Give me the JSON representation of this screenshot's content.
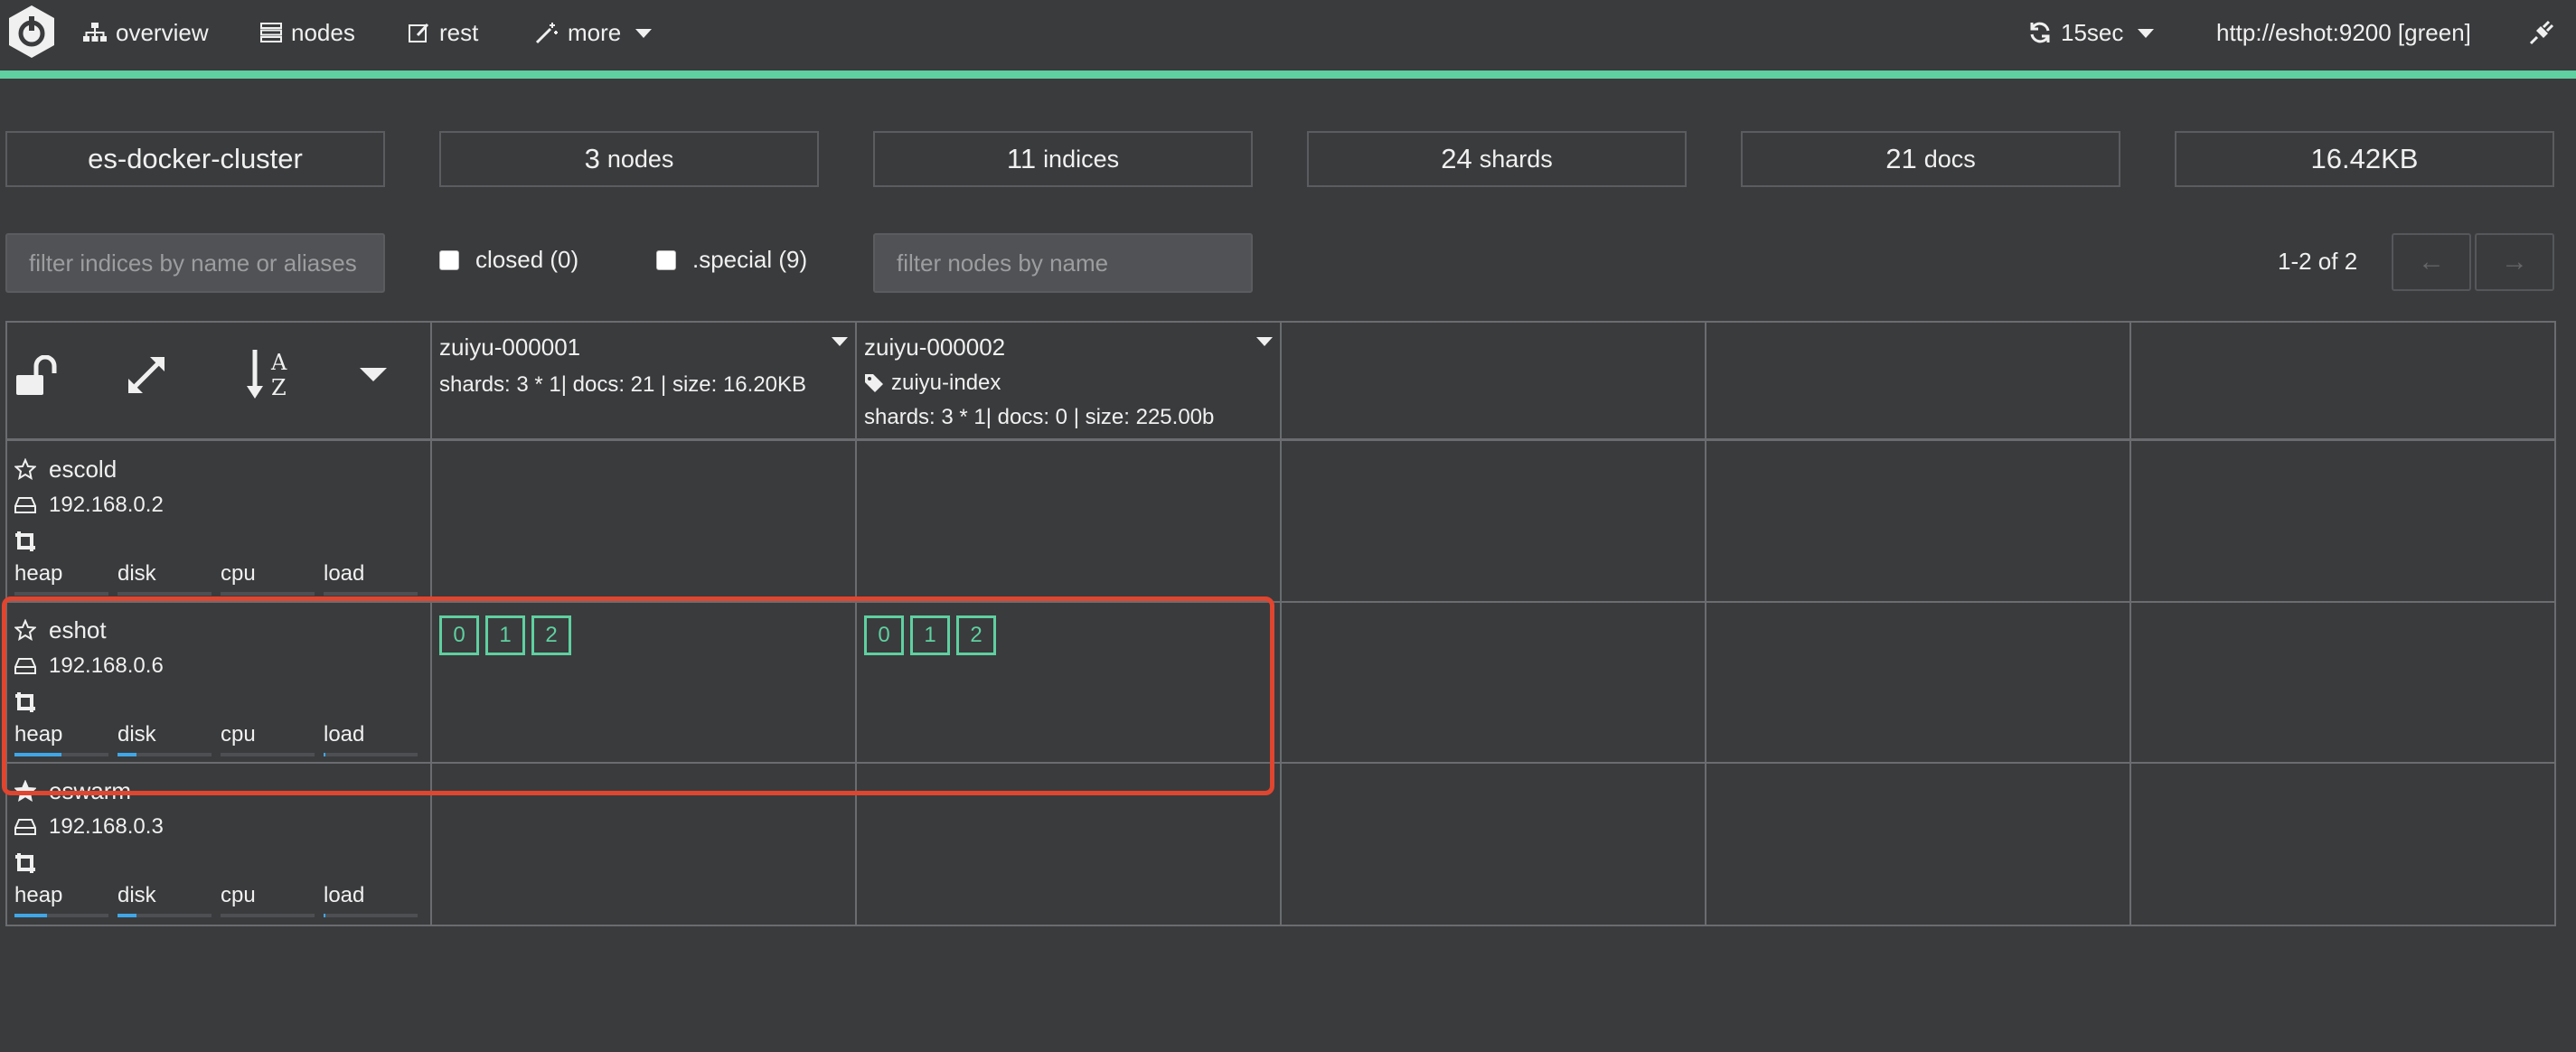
{
  "nav": {
    "overview": "overview",
    "nodes": "nodes",
    "rest": "rest",
    "more": "more",
    "refresh": "15sec",
    "host": "http://eshot:9200 [green]"
  },
  "stats": {
    "cluster_name": "es-docker-cluster",
    "nodes_count": "3",
    "nodes_label": "nodes",
    "indices_count": "11",
    "indices_label": "indices",
    "shards_count": "24",
    "shards_label": "shards",
    "docs_count": "21",
    "docs_label": "docs",
    "size": "16.42KB"
  },
  "filters": {
    "indices_placeholder": "filter indices by name or aliases",
    "closed_label": "closed (0)",
    "special_label": ".special (9)",
    "nodes_placeholder": "filter nodes by name",
    "pager": "1-2 of 2",
    "prev": "←",
    "next": "→"
  },
  "indices": [
    {
      "name": "zuiyu-000001",
      "meta": "shards: 3 * 1| docs: 21 | size: 16.20KB"
    },
    {
      "name": "zuiyu-000002",
      "alias": "zuiyu-index",
      "meta": "shards: 3 * 1| docs: 0 | size: 225.00b"
    }
  ],
  "metric_labels": {
    "heap": "heap",
    "disk": "disk",
    "cpu": "cpu",
    "load": "load"
  },
  "nodes": [
    {
      "name": "escold",
      "ip": "192.168.0.2",
      "heap": 0.0,
      "disk": 0.0,
      "cpu": 0.0,
      "load": 0.0
    },
    {
      "name": "eshot",
      "ip": "192.168.0.6",
      "heap": 0.5,
      "disk": 0.2,
      "cpu": 0.0,
      "load": 0.02
    },
    {
      "name": "eswarm",
      "ip": "192.168.0.3",
      "heap": 0.35,
      "disk": 0.2,
      "cpu": 0.0,
      "load": 0.02
    }
  ],
  "shards": {
    "eshot": {
      "zuiyu-000001": [
        "0",
        "1",
        "2"
      ],
      "zuiyu-000002": [
        "0",
        "1",
        "2"
      ]
    }
  },
  "colors": {
    "accent": "#5fd0a0",
    "bar": "#3fa7e8",
    "highlight": "#e0452f"
  }
}
